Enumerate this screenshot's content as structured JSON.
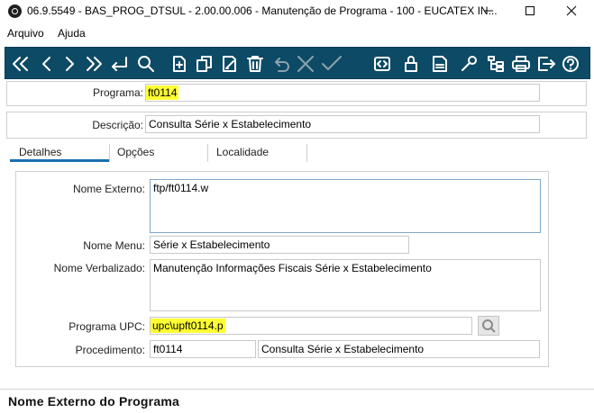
{
  "window": {
    "title": "06.9.5549 - BAS_PROG_DTSUL - 2.00.00.006 - Manutenção de Programa - 100 - EUCATEX IN..."
  },
  "menu": {
    "items": [
      "Arquivo",
      "Ajuda"
    ]
  },
  "toolbar": {
    "buttons": [
      "first-icon",
      "previous-icon",
      "next-icon",
      "last-icon",
      "goto-icon",
      "search-icon",
      "new-icon",
      "copy-icon",
      "edit-icon",
      "delete-icon",
      "undo-icon",
      "cancel-icon",
      "confirm-icon",
      "related-icon",
      "lock-icon",
      "pdf-icon",
      "tools-icon",
      "tree-icon",
      "print-icon",
      "exit-icon",
      "help-icon"
    ],
    "background": "#0d4a66"
  },
  "form": {
    "programa_label": "Programa:",
    "programa_value": "ft0114",
    "descricao_label": "Descrição:",
    "descricao_value": "Consulta Série x Estabelecimento"
  },
  "tabs": [
    "Detalhes",
    "Opções",
    "Localidade"
  ],
  "details": {
    "nome_externo_label": "Nome Externo:",
    "nome_externo_value": "ftp/ft0114.w",
    "nome_menu_label": "Nome Menu:",
    "nome_menu_value": "Série x Estabelecimento",
    "nome_verbalizado_label": "Nome Verbalizado:",
    "nome_verbalizado_value": "Manutenção Informações Fiscais Série x Estabelecimento",
    "programa_upc_label": "Programa UPC:",
    "programa_upc_value": "upc\\upft0114.p",
    "procedimento_label": "Procedimento:",
    "procedimento_code": "ft0114",
    "procedimento_desc": "Consulta Série x Estabelecimento"
  },
  "status": {
    "text": "Nome Externo do Programa"
  },
  "colors": {
    "highlight": "#ffff33",
    "active_tab": "#1b6fb0"
  }
}
